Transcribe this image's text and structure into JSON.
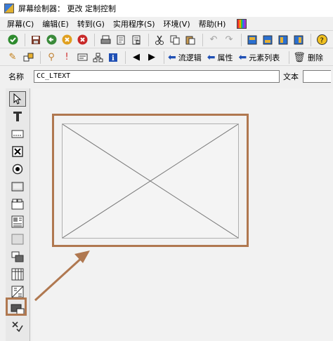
{
  "window": {
    "title": "屏幕绘制器： 更改 定制控制"
  },
  "menu": [
    {
      "label": "屏幕(C)"
    },
    {
      "label": "编辑(E)"
    },
    {
      "label": "转到(G)"
    },
    {
      "label": "实用程序(S)"
    },
    {
      "label": "环境(V)"
    },
    {
      "label": "帮助(H)"
    }
  ],
  "toolbar2": {
    "flow_logic": "流逻辑",
    "attributes": "属性",
    "element_list": "元素列表",
    "delete": "删除"
  },
  "name_row": {
    "name_label": "名称",
    "name_value": "CC_LTEXT",
    "text_label": "文本"
  },
  "colors": {
    "highlight": "#b07850",
    "arrow_blue": "#1f4fb4"
  },
  "palette_icons": [
    "pointer-icon",
    "text-icon",
    "input-field-icon",
    "checkbox-icon",
    "radio-button-icon",
    "pushbutton-icon",
    "frame-icon",
    "tabstrip-icon",
    "subscreen-icon",
    "table-control-icon",
    "step-loop-icon",
    "custom-control-icon",
    "status-icon"
  ]
}
